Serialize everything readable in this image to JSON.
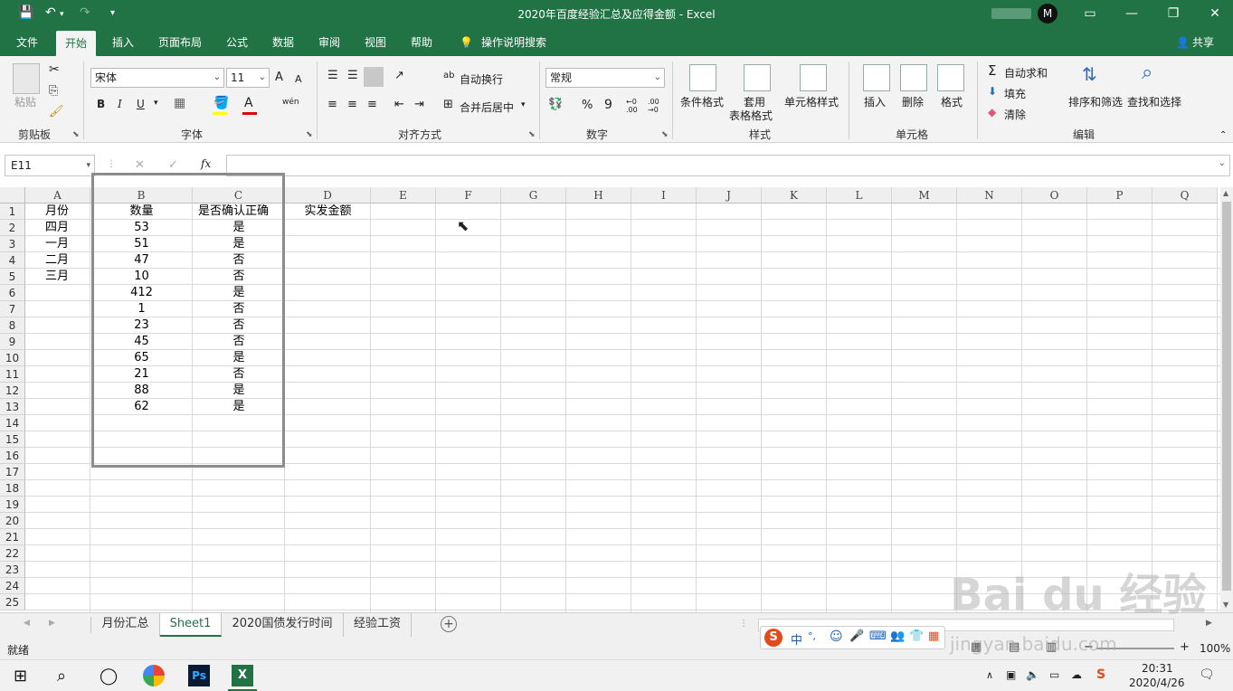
{
  "window": {
    "title": "2020年百度经验汇总及应得金额 - Excel",
    "colors": {
      "excel_green": "#217346",
      "ribbon_bg": "#f3f3f3"
    }
  },
  "tabs": [
    "文件",
    "开始",
    "插入",
    "页面布局",
    "公式",
    "数据",
    "审阅",
    "视图",
    "帮助",
    "操作说明搜索"
  ],
  "share_label": "共享",
  "ribbon": {
    "clipboard": {
      "paste": "粘贴",
      "label": "剪贴板"
    },
    "font": {
      "name": "宋体",
      "size": "11",
      "bold": "B",
      "italic": "I",
      "underline": "U",
      "label": "字体",
      "grow": "A",
      "shrink": "A",
      "font_color": "A",
      "phonetic": "wén"
    },
    "alignment": {
      "wrap": "自动换行",
      "merge": "合并后居中",
      "label": "对齐方式",
      "wrap_ab": "ab"
    },
    "number": {
      "format": "常规",
      "percent": "%",
      "comma": "9",
      "inc": "←0 .00",
      "dec": ".00 →0",
      "label": "数字"
    },
    "styles": {
      "conditional": "条件格式",
      "table1": "套用",
      "table2": "表格格式",
      "cell_styles": "单元格样式",
      "label": "样式"
    },
    "cells": {
      "insert": "插入",
      "delete": "删除",
      "format": "格式",
      "label": "单元格"
    },
    "editing": {
      "autosum": "自动求和",
      "fill": "填充",
      "clear": "清除",
      "sort": "排序和筛选",
      "find": "查找和选择",
      "label": "编辑"
    }
  },
  "formula_bar": {
    "name_box": "E11",
    "fx": "fx",
    "cancel": "✕",
    "enter": "✓",
    "value": ""
  },
  "columns": [
    "A",
    "B",
    "C",
    "D",
    "E",
    "F",
    "G",
    "H",
    "I",
    "J",
    "K",
    "L",
    "M",
    "N",
    "O",
    "P",
    "Q"
  ],
  "rows": [
    "1",
    "2",
    "3",
    "4",
    "5",
    "6",
    "7",
    "8",
    "9",
    "10",
    "11",
    "12",
    "13",
    "14",
    "15",
    "16",
    "17",
    "18",
    "19",
    "20",
    "21",
    "22",
    "23",
    "24",
    "25"
  ],
  "cells": {
    "headers": [
      "月份",
      "数量",
      "是否确认正确",
      "实发金额"
    ],
    "months": [
      "四月",
      "一月",
      "二月",
      "三月"
    ],
    "qty": [
      "53",
      "51",
      "47",
      "10",
      "412",
      "1",
      "23",
      "45",
      "65",
      "21",
      "88",
      "62"
    ],
    "confirm": [
      "是",
      "是",
      "否",
      "否",
      "是",
      "否",
      "否",
      "否",
      "是",
      "否",
      "是",
      "是"
    ]
  },
  "sheets": [
    "月份汇总",
    "Sheet1",
    "2020国债发行时间",
    "经验工资"
  ],
  "status": {
    "ready": "就绪",
    "zoom": "100%",
    "minus": "−",
    "plus": "+"
  },
  "taskbar": {
    "time": "20:31",
    "date": "2020/4/26",
    "ps": "Ps"
  },
  "ime": {
    "zh": "中",
    "punct": "°,"
  },
  "watermark": {
    "logo": "Bai du 经验",
    "url": "jingyan.baidu.com"
  }
}
